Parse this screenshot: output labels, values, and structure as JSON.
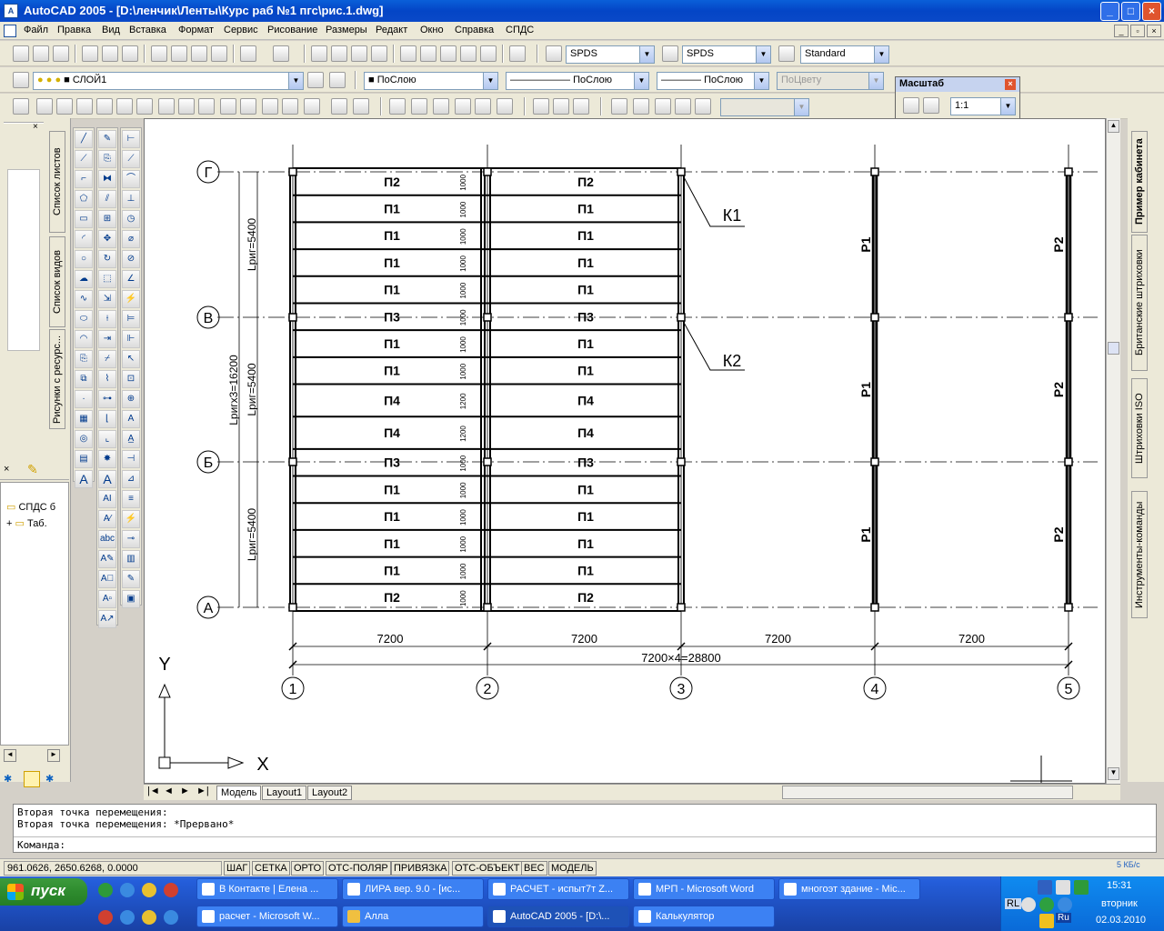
{
  "window": {
    "title": "AutoCAD 2005 - [D:\\ленчик\\Ленты\\Курс раб №1 пгс\\рис.1.dwg]",
    "minimize": "_",
    "maximize": "□",
    "close": "×"
  },
  "menu": {
    "items": [
      "Файл",
      "Правка",
      "Вид",
      "Вставка",
      "Формат",
      "Сервис",
      "Рисование",
      "Размеры",
      "Редакт",
      "Окно",
      "Справка",
      "СПДС"
    ]
  },
  "toolbar": {
    "text_style": "SPDS",
    "dim_style": "SPDS",
    "table_style": "Standard",
    "layer": "СЛОЙ1",
    "color": "ПоСлою",
    "linetype": "ПоСлою",
    "lineweight": "ПоСлою",
    "plotstyle": "ПоЦвету"
  },
  "scale_panel": {
    "title": "Масштаб",
    "value": "1:1"
  },
  "left_dock": {
    "tabs": [
      "Список листов",
      "Список видов",
      "Рисунки с ресурс..."
    ],
    "tree": [
      {
        "label": "СПДС б",
        "expander": ""
      },
      {
        "label": "Таб.",
        "expander": "+"
      }
    ]
  },
  "right_dock": {
    "tabs": [
      "Пример кабинета",
      "Британские штриховки",
      "Штриховки ISO",
      "Инструменты-команды"
    ]
  },
  "drawing": {
    "grid_axes_rows": [
      "Г",
      "В",
      "Б",
      "А"
    ],
    "grid_axes_cols": [
      "1",
      "2",
      "3",
      "4",
      "5"
    ],
    "bay_dims": [
      "7200",
      "7200",
      "7200",
      "7200"
    ],
    "total_dim": "7200×4=28800",
    "span_dims": [
      "Lриг=5400",
      "Lриг=5400",
      "Lриг=5400"
    ],
    "total_span": "Lригх3=16200",
    "slabs": [
      "П2",
      "П1",
      "П1",
      "П1",
      "П1",
      "П3",
      "П1",
      "П1",
      "П4",
      "П4",
      "П3",
      "П1",
      "П1",
      "П1",
      "П1",
      "П2"
    ],
    "slab_widths": [
      "1000",
      "1000",
      "1000",
      "1000",
      "1000",
      "1000",
      "1000",
      "1000",
      "1200",
      "1200",
      "1000",
      "1000",
      "1000",
      "1000",
      "1000",
      "1000"
    ],
    "leaders": [
      "К1",
      "К2"
    ],
    "beams_col4": [
      "Р1",
      "Р1",
      "Р1"
    ],
    "beams_col5": [
      "Р2",
      "Р2",
      "Р2"
    ],
    "ucs_x": "X",
    "ucs_y": "Y"
  },
  "layout_tabs": [
    "Модель",
    "Layout1",
    "Layout2"
  ],
  "command": {
    "lines": [
      "Вторая точка перемещения:",
      "Вторая точка перемещения: *Прервано*"
    ],
    "prompt": "Команда:"
  },
  "status": {
    "coords": "961.0626, 2650.6268, 0.0000",
    "buttons": [
      "ШАГ",
      "СЕТКА",
      "ОРТО",
      "ОТС-ПОЛЯР",
      "ПРИВЯЗКА",
      "ОТС-ОБЪЕКТ",
      "ВЕС",
      "МОДЕЛЬ"
    ],
    "net_speed": "5 КБ/с"
  },
  "taskbar": {
    "start": "пуск",
    "tasks_row1": [
      "В Контакте | Елена ...",
      "ЛИРА вер. 9.0 - [ис...",
      "РАСЧЕТ - испыт7т Z...",
      "МРП - Microsoft Word",
      "многоэт здание - Mic..."
    ],
    "tasks_row2": [
      "расчет - Microsoft W...",
      "Алла",
      "AutoCAD 2005 - [D:\\...",
      "Калькулятор"
    ],
    "lang": "RL",
    "lang2": "Ru",
    "time": "15:31",
    "day": "вторник",
    "date": "02.03.2010"
  }
}
